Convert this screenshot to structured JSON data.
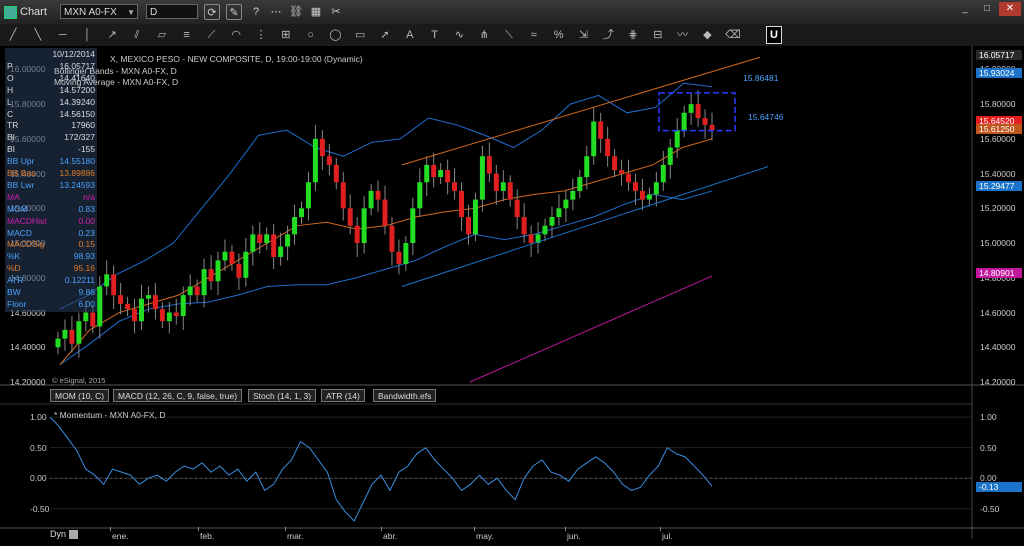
{
  "window": {
    "title": "Chart",
    "minimize": "_",
    "maximize": "□",
    "close": "✕"
  },
  "toolbar": {
    "symbol": "MXN A0-FX",
    "interval": "D",
    "icons": [
      "refresh-icon",
      "pencil-icon",
      "question-icon",
      "dots-icon",
      "link-icon",
      "calendar-icon",
      "tools-icon"
    ]
  },
  "drawing_tools": [
    "line-tool",
    "line-tool-2",
    "horizontal-line-tool",
    "vertical-line-tool",
    "ray-tool",
    "parallel-channel-tool",
    "channel-tool",
    "fibonacci-tool",
    "fib-fan-tool",
    "fib-arc-tool",
    "fib-time-tool",
    "gann-tool",
    "circle-tool",
    "ellipse-tool",
    "rectangle-tool",
    "arrow-tool",
    "text-tool",
    "label-tool",
    "cycle-tool",
    "pitchfork-tool",
    "speed-line-tool",
    "regression-tool",
    "percent-tool",
    "measure-tool",
    "trend-tool",
    "andrews-tool",
    "tirone-tool",
    "wave-tool",
    "marker-tool",
    "eraser-tool"
  ],
  "drawing_tool_u_label": "U",
  "data_window": [
    {
      "label": "",
      "value": "10/12/2014"
    },
    {
      "label": "P",
      "value": "16.05717"
    },
    {
      "label": "O",
      "value": "14.41640"
    },
    {
      "label": "H",
      "value": "14.57200"
    },
    {
      "label": "L",
      "value": "14.39240"
    },
    {
      "label": "C",
      "value": "14.56150"
    },
    {
      "label": "TR",
      "value": "17960"
    },
    {
      "label": "BI",
      "value": "172/327"
    },
    {
      "label": "BI",
      "value": "-155"
    },
    {
      "label": "BB Upr",
      "value": "14.55180"
    },
    {
      "label": "BB Bas",
      "value": "13.89886"
    },
    {
      "label": "BB Lwr",
      "value": "13.24593"
    },
    {
      "label": "MA",
      "value": "n/a"
    },
    {
      "label": "MOM",
      "value": "0.83"
    },
    {
      "label": "MACDHist",
      "value": "0.00"
    },
    {
      "label": "MACD",
      "value": "0.23"
    },
    {
      "label": "MACDSig",
      "value": "0.15"
    },
    {
      "label": "%K",
      "value": "98.93"
    },
    {
      "label": "%D",
      "value": "95.16"
    },
    {
      "label": "ATR",
      "value": "0.12211"
    },
    {
      "label": "BW",
      "value": "9.86"
    },
    {
      "label": "Floor",
      "value": "6.00"
    }
  ],
  "legend": {
    "main": "X, MEXICO PESO - NEW COMPOSITE, D, 19:00-19:00 (Dynamic)",
    "bands": "Bollinger Bands - MXN A0-FX, D",
    "ma": "Moving Average - MXN A0-FX, D",
    "momentum": "* Momentum - MXN A0-FX, D"
  },
  "credit": "© eSignal, 2015",
  "indicator_tabs": [
    "MOM (10, C)",
    "MACD (12, 26, C, 9, false, true)",
    "Stoch (14, 1, 3)",
    "ATR (14)",
    "Bandwidth.efs"
  ],
  "annotations": {
    "box_high": "15.86481",
    "box_low": "15.64746"
  },
  "price_axis_ticks": [
    "16.00000",
    "15.80000",
    "15.60000",
    "15.40000",
    "15.20000",
    "15.00000",
    "14.80000",
    "14.60000",
    "14.40000",
    "14.20000"
  ],
  "right_axis_ticks": [
    "16.00000",
    "15.80000",
    "15.60000",
    "15.40000",
    "15.20000",
    "15.00000",
    "14.80000",
    "14.60000",
    "14.40000",
    "14.20000"
  ],
  "right_axis_labels": [
    {
      "text": "16.05717",
      "color": "#2a2a2a"
    },
    {
      "text": "15.93024",
      "color": "#1a73c8"
    },
    {
      "text": "15.64520",
      "color": "#e21e1e"
    },
    {
      "text": "15.61250",
      "color": "#c0561d"
    },
    {
      "text": "15.29477",
      "color": "#1a73c8"
    },
    {
      "text": "14.80901",
      "color": "#c2189e"
    }
  ],
  "momentum_ticks": [
    "1.00",
    "0.50",
    "0.00",
    "-0.50"
  ],
  "momentum_right_ticks": [
    "1.00",
    "0.50",
    "0.00",
    "-0.50"
  ],
  "momentum_current": "-0.13",
  "dyn_label": "Dyn",
  "months": [
    "ene.",
    "feb.",
    "mar.",
    "abr.",
    "may.",
    "jun.",
    "jul."
  ],
  "chart_data": {
    "type": "candlestick",
    "title": "MXN A0-FX, MEXICO PESO - NEW COMPOSITE, D",
    "ylim": [
      14.2,
      16.1
    ],
    "ohlc_close": [
      14.45,
      14.5,
      14.42,
      14.55,
      14.6,
      14.52,
      14.75,
      14.82,
      14.7,
      14.65,
      14.62,
      14.55,
      14.68,
      14.7,
      14.62,
      14.55,
      14.6,
      14.58,
      14.7,
      14.75,
      14.7,
      14.85,
      14.78,
      14.9,
      14.95,
      14.88,
      14.8,
      14.95,
      15.05,
      15.0,
      15.05,
      14.92,
      14.98,
      15.05,
      15.15,
      15.2,
      15.35,
      15.6,
      15.5,
      15.45,
      15.35,
      15.2,
      15.1,
      15.0,
      15.2,
      15.3,
      15.25,
      15.1,
      14.95,
      14.88,
      15.0,
      15.2,
      15.35,
      15.45,
      15.38,
      15.42,
      15.35,
      15.3,
      15.15,
      15.05,
      15.25,
      15.5,
      15.4,
      15.3,
      15.35,
      15.25,
      15.15,
      15.05,
      15.0,
      15.05,
      15.1,
      15.15,
      15.2,
      15.25,
      15.3,
      15.38,
      15.5,
      15.7,
      15.6,
      15.5,
      15.42,
      15.4,
      15.35,
      15.3,
      15.25,
      15.28,
      15.35,
      15.45,
      15.55,
      15.65,
      15.75,
      15.8,
      15.72,
      15.68,
      15.65
    ],
    "bollinger_upper": [
      14.62,
      14.7,
      14.82,
      14.9,
      15.0,
      15.2,
      15.4,
      15.62,
      15.65,
      15.55,
      15.5,
      15.58,
      15.6,
      15.72,
      15.68,
      15.62,
      15.55,
      15.65,
      15.8,
      15.85,
      15.75,
      15.78,
      15.92,
      15.9
    ],
    "bollinger_lower": [
      14.3,
      14.42,
      14.55,
      14.62,
      14.65,
      14.66,
      14.7,
      14.75,
      14.76,
      14.76,
      14.8,
      14.85,
      14.9,
      14.98,
      15.05,
      15.02,
      15.05,
      15.1,
      15.15,
      15.22,
      15.28,
      15.25,
      15.3
    ],
    "moving_average": [
      14.3,
      14.5,
      14.6,
      14.65,
      14.7,
      14.8,
      14.9,
      15.0,
      15.1,
      15.12,
      15.08,
      15.1,
      15.15,
      15.18,
      15.2,
      15.25,
      15.28,
      15.3,
      15.35,
      15.4,
      15.45,
      15.55,
      15.6
    ],
    "trend_lines": [
      {
        "name": "upper channel",
        "color": "#d2691e",
        "from": [
          "mar.",
          15.45
        ],
        "to": [
          "jul.",
          16.07
        ]
      },
      {
        "name": "lower channel",
        "color": "#1a73c8",
        "from": [
          "abr.",
          14.75
        ],
        "to": [
          "jul.",
          15.44
        ]
      },
      {
        "name": "magenta line",
        "color": "#c2189e",
        "from": [
          "abr.",
          14.2
        ],
        "to": [
          "jul.",
          14.81
        ]
      }
    ],
    "momentum": [
      1.0,
      0.85,
      0.65,
      0.45,
      0.15,
      0.05,
      -0.1,
      0.15,
      0.1,
      0.05,
      -0.1,
      0.0,
      0.05,
      -0.05,
      0.1,
      0.2,
      0.15,
      0.25,
      0.1,
      0.2,
      0.05,
      0.15,
      -0.05,
      0.1,
      -0.2,
      -0.1,
      0.15,
      0.3,
      0.6,
      0.5,
      0.3,
      0.1,
      -0.35,
      -0.55,
      -0.7,
      -0.4,
      -0.1,
      0.05,
      -0.2,
      0.1,
      0.2,
      0.4,
      0.5,
      0.3,
      0.15,
      0.0,
      -0.2,
      -0.1,
      0.05,
      -0.1,
      0.0,
      -0.2,
      -0.35,
      0.0,
      0.2,
      0.3,
      0.1,
      0.05,
      -0.05,
      0.15,
      0.25,
      0.35,
      0.25,
      0.1,
      -0.1,
      -0.2,
      -0.15,
      0.05,
      0.2,
      0.5,
      0.4,
      0.35,
      0.2,
      0.05,
      -0.13
    ],
    "momentum_ylim": [
      -0.75,
      1.15
    ]
  }
}
